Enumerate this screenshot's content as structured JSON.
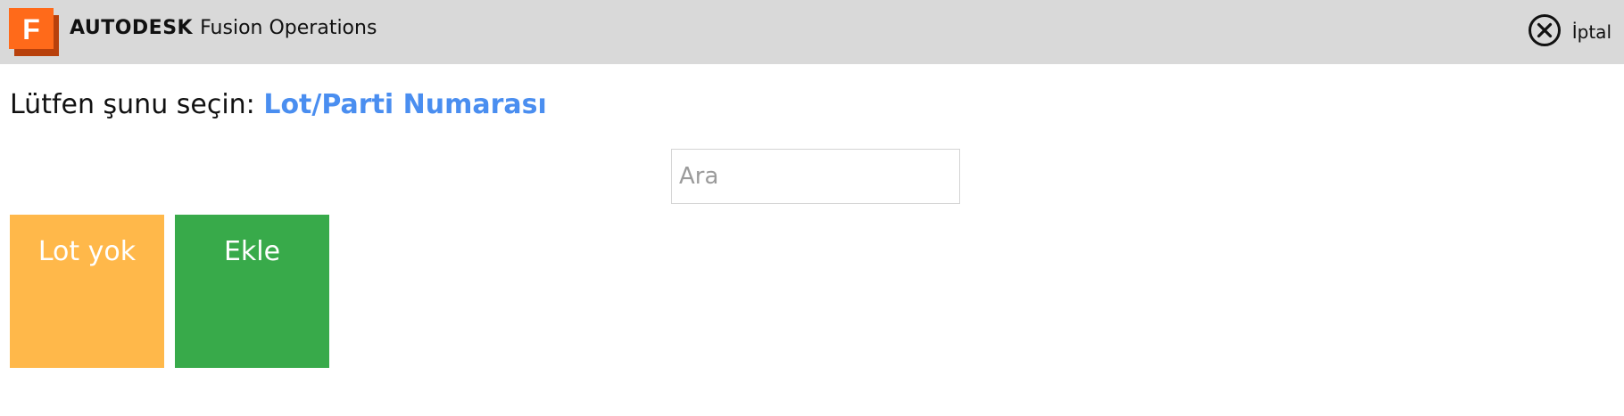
{
  "header": {
    "brand_bold": "AUTODESK",
    "brand_product": "Fusion Operations",
    "logo_letter": "F",
    "logo_icon": "fusion-logo-icon",
    "cancel_icon": "close-circle-icon",
    "cancel_label": "İptal"
  },
  "prompt": {
    "prefix": "Lütfen şunu seçin:",
    "highlight": "Lot/Parti Numarası"
  },
  "search": {
    "placeholder": "Ara",
    "value": ""
  },
  "tiles": [
    {
      "label": "Lot yok",
      "color": "#ffb84a"
    },
    {
      "label": "Ekle",
      "color": "#38aa4a"
    }
  ],
  "colors": {
    "topbar": "#d9d9d9",
    "accent": "#4a8ef0",
    "logo_orange": "#ff6a1a"
  }
}
